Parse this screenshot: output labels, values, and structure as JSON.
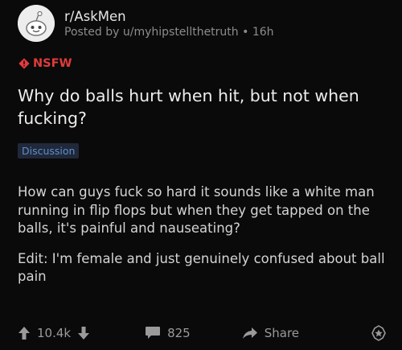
{
  "post": {
    "subreddit": "r/AskMen",
    "posted_by": "Posted by u/myhipstellthetruth • 16h",
    "nsfw_label": "NSFW",
    "title": "Why do balls hurt when hit, but not when fucking?",
    "flair": "Discussion",
    "body": [
      "How can guys fuck so hard it sounds like a white man running in flip flops but when they get tapped on the balls, it's painful and nauseating?",
      "Edit: I'm female and just genuinely confused about ball pain"
    ]
  },
  "actions": {
    "upvotes": "10.4k",
    "comments": "825",
    "share_label": "Share"
  },
  "colors": {
    "background": "#0a0a0a",
    "nsfw": "#e23b3b",
    "flair_text": "#5f8fc9"
  },
  "icons": {
    "avatar": "snoo-avatar-icon",
    "nsfw": "nsfw-diamond-icon",
    "upvote": "arrow-up-icon",
    "downvote": "arrow-down-icon",
    "comment": "comment-bubble-icon",
    "share": "share-arrow-icon",
    "award": "award-star-icon"
  }
}
